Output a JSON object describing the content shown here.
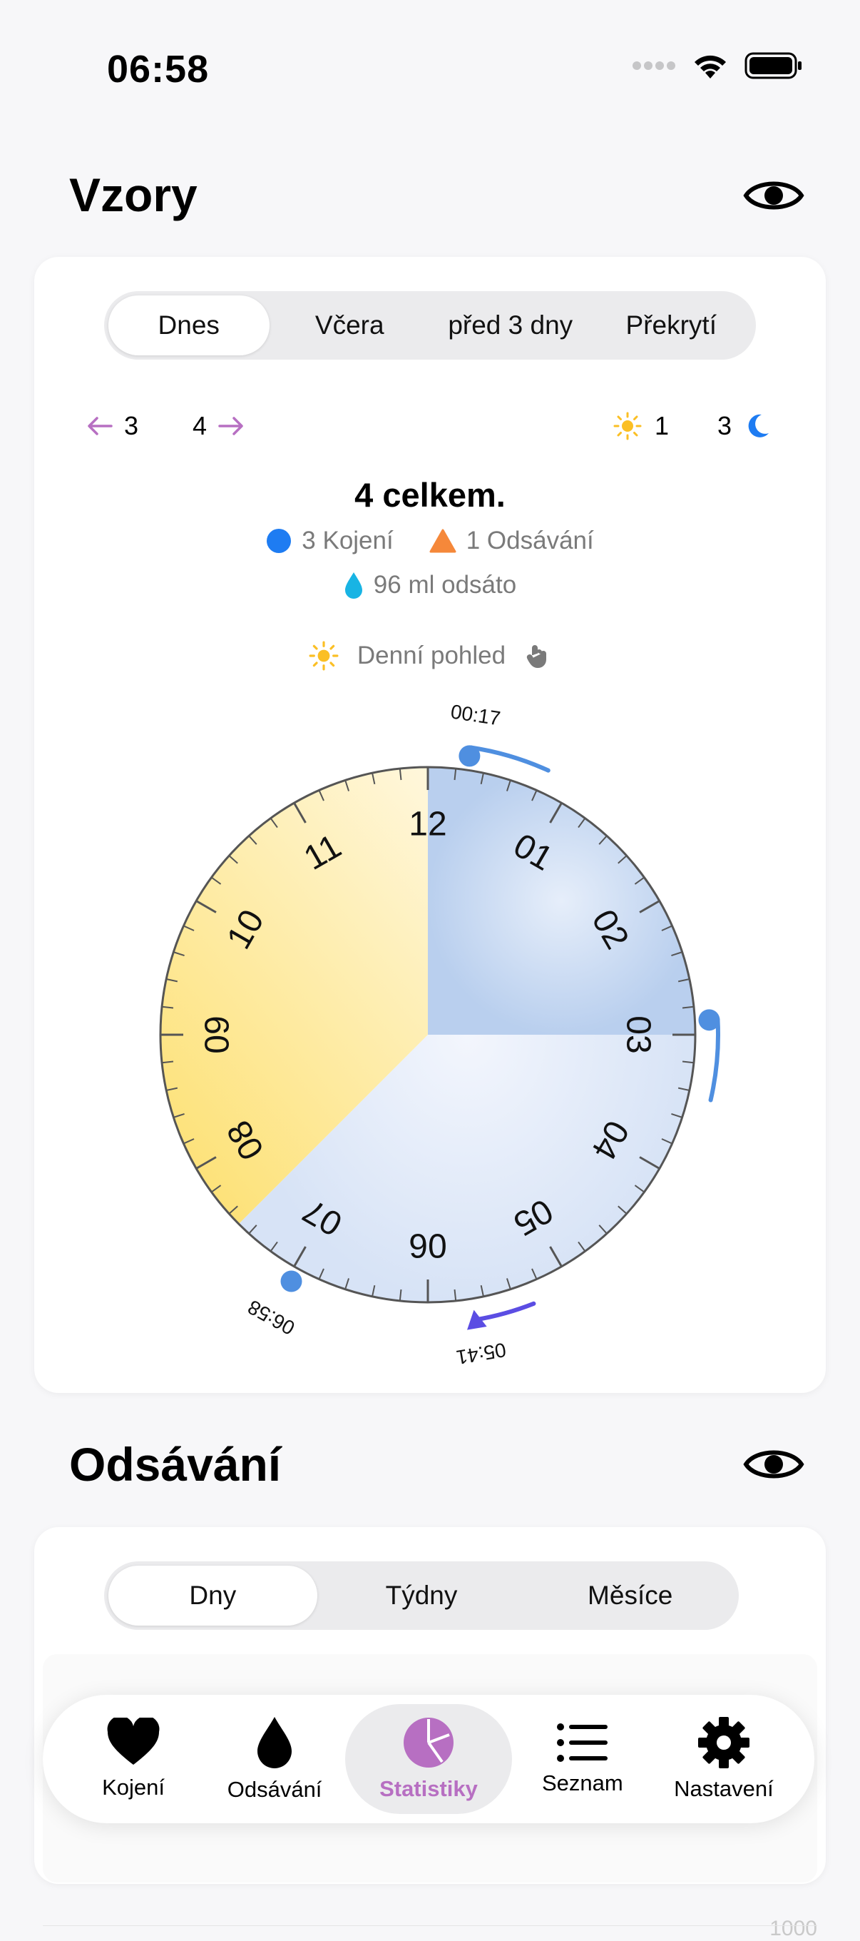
{
  "status": {
    "time": "06:58"
  },
  "patterns": {
    "title": "Vzory",
    "tabs": [
      {
        "label": "Dnes",
        "active": true
      },
      {
        "label": "Včera",
        "active": false
      },
      {
        "label": "před 3 dny",
        "active": false
      },
      {
        "label": "Překrytí",
        "active": false
      }
    ],
    "prev_count": "3",
    "next_count": "4",
    "day_count": "1",
    "night_count": "3",
    "total": "4 celkem.",
    "legend_feeding": "3 Kojení",
    "legend_pumping": "1 Odsávání",
    "pumped_amount": "96 ml odsáto",
    "view_mode": "Denní pohled",
    "clock_numbers": [
      "12",
      "01",
      "02",
      "03",
      "04",
      "05",
      "06",
      "07",
      "08",
      "09",
      "10",
      "11"
    ],
    "events": [
      {
        "time": "00:17",
        "type": "feeding"
      },
      {
        "time": "02:54",
        "type": "feeding"
      },
      {
        "time": "05:41",
        "type": "pumping"
      },
      {
        "time": "06:58",
        "type": "feeding"
      }
    ],
    "colors": {
      "feeding": "#4f8fe0",
      "pumping": "#5b4de3",
      "day": "#fde68a",
      "night": "#c0d3f0"
    }
  },
  "pumping_section": {
    "title": "Odsávání",
    "tabs": [
      {
        "label": "Dny",
        "active": true
      },
      {
        "label": "Týdny",
        "active": false
      },
      {
        "label": "Měsíce",
        "active": false
      }
    ],
    "axis_value": "1000"
  },
  "tab_bar": {
    "items": [
      {
        "label": "Kojení",
        "icon": "heart-icon",
        "active": false
      },
      {
        "label": "Odsávání",
        "icon": "drop-icon",
        "active": false
      },
      {
        "label": "Statistiky",
        "icon": "pie-chart-icon",
        "active": true
      },
      {
        "label": "Seznam",
        "icon": "list-icon",
        "active": false
      },
      {
        "label": "Nastavení",
        "icon": "gear-icon",
        "active": false
      }
    ]
  }
}
